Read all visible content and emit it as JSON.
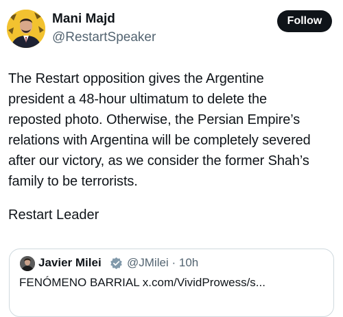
{
  "author": {
    "name": "Mani Majd",
    "handle": "@RestartSpeaker",
    "avatar_icon": "profile-photo"
  },
  "follow_button": {
    "label": "Follow",
    "background": "#0f1419",
    "color": "#ffffff"
  },
  "post": {
    "lines": [
      "The Restart opposition gives the Argentine",
      "president a 48-hour ultimatum to delete the",
      "reposted photo. Otherwise, the Persian Empire’s",
      "relations with Argentina will be completely severed",
      "after our victory, as we consider the former Shah’s",
      "family to be terrorists."
    ],
    "signature": "Restart Leader"
  },
  "quoted_post": {
    "name": "Javier Milei",
    "verified_icon": "verified-badge-icon",
    "handle": "@JMilei",
    "separator": "·",
    "time": "10h",
    "text": "FENÓMENO BARRIAL x.com/VividProwess/s..."
  },
  "colors": {
    "text": "#0f1419",
    "secondary_text": "#536471",
    "border": "#cfd9de",
    "verified": "#829aab"
  }
}
